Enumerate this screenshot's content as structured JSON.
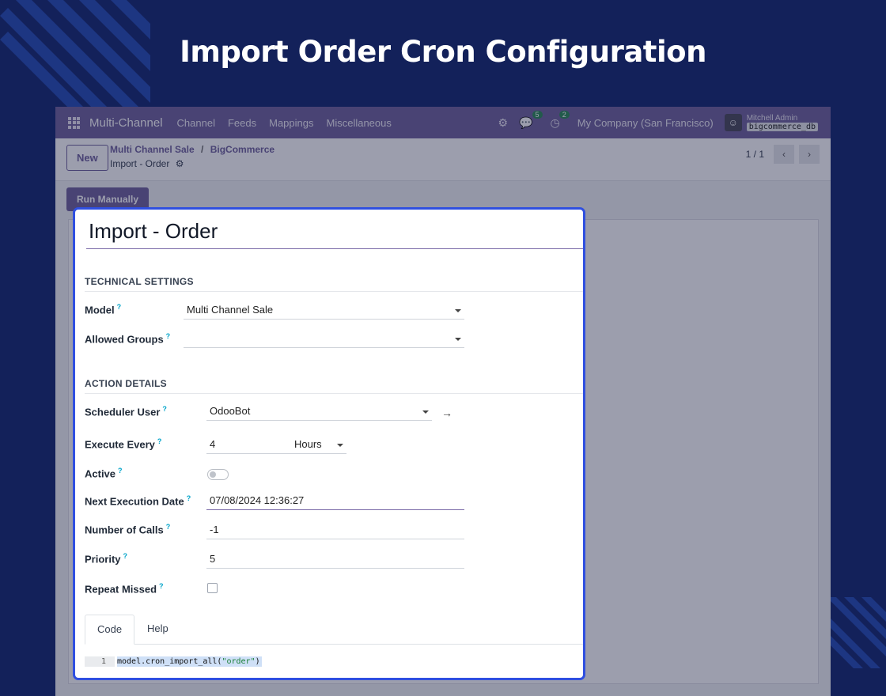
{
  "headline": "Import Order Cron Configuration",
  "navbar": {
    "app_name": "Multi-Channel",
    "menu": [
      "Channel",
      "Feeds",
      "Mappings",
      "Miscellaneous"
    ],
    "messages_count": "5",
    "activities_count": "2",
    "company": "My Company (San Francisco)",
    "user_name": "Mitchell Admin",
    "database": "bigcommerce_db"
  },
  "control_panel": {
    "new_label": "New",
    "breadcrumb_parent": "Multi Channel Sale",
    "breadcrumb_separator": "/",
    "breadcrumb_child": "BigCommerce",
    "current_record": "Import - Order",
    "pager": "1 / 1"
  },
  "run_manually_label": "Run Manually",
  "form": {
    "title": "Import - Order",
    "technical_section": "TECHNICAL SETTINGS",
    "model_label": "Model",
    "model_value": "Multi Channel Sale",
    "allowed_groups_label": "Allowed Groups",
    "allowed_groups_value": "",
    "action_section": "ACTION DETAILS",
    "scheduler_user_label": "Scheduler User",
    "scheduler_user_value": "OdooBot",
    "execute_every_label": "Execute Every",
    "execute_every_value": "4",
    "execute_every_unit": "Hours",
    "active_label": "Active",
    "active_on": false,
    "next_exec_label": "Next Execution Date",
    "next_exec_value": "07/08/2024 12:36:27",
    "number_calls_label": "Number of Calls",
    "number_calls_value": "-1",
    "priority_label": "Priority",
    "priority_value": "5",
    "repeat_missed_label": "Repeat Missed",
    "repeat_missed_checked": false,
    "help_mark": "?"
  },
  "tabs": [
    "Code",
    "Help"
  ],
  "code": {
    "line_number": "1",
    "prefix": "model.cron_import_all(",
    "string": "\"order\"",
    "suffix": ")"
  },
  "colors": {
    "background": "#13215a",
    "navbar": "#71639e",
    "highlight_border": "#2f4fe0",
    "help_mark": "#00a3c9"
  }
}
